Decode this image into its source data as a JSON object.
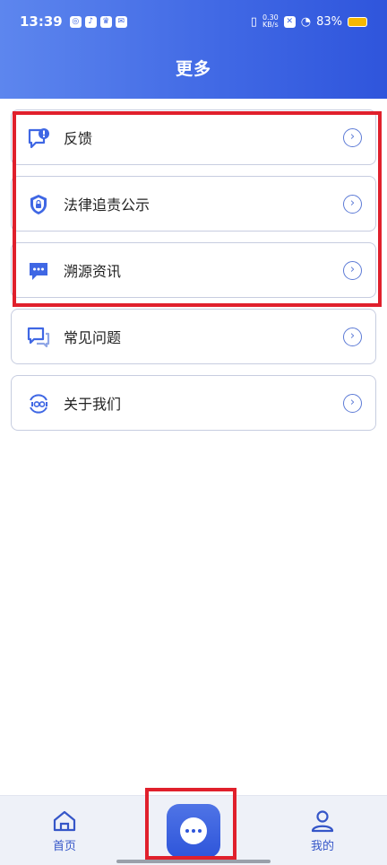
{
  "status_bar": {
    "time": "13:39",
    "net_speed_top": "0.30",
    "net_speed_bottom": "KB/s",
    "battery": "83%"
  },
  "header": {
    "title": "更多"
  },
  "menu": {
    "items": [
      {
        "label": "反馈",
        "icon": "feedback-icon"
      },
      {
        "label": "法律追责公示",
        "icon": "shield-lock-icon"
      },
      {
        "label": "溯源资讯",
        "icon": "message-dots-icon"
      },
      {
        "label": "常见问题",
        "icon": "chat-bubbles-icon"
      },
      {
        "label": "关于我们",
        "icon": "about-logo-icon"
      }
    ]
  },
  "bottom_nav": {
    "home_label": "首页",
    "mine_label": "我的"
  },
  "colors": {
    "accent": "#3f67e4",
    "highlight": "#e0202c",
    "card_border": "#c7cde0"
  }
}
